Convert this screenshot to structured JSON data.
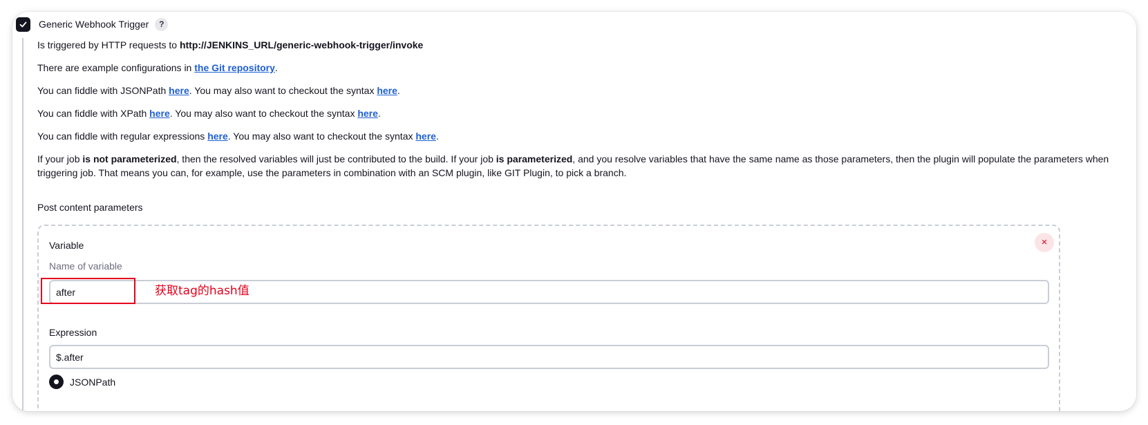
{
  "trigger": {
    "checked": true,
    "title": "Generic Webhook Trigger",
    "help_label": "?"
  },
  "intro": {
    "invoke_prefix": "Is triggered by HTTP requests to ",
    "invoke_url": "http://JENKINS_URL/generic-webhook-trigger/invoke",
    "examples_prefix": "There are example configurations in ",
    "examples_link": "the Git repository",
    "examples_suffix": ".",
    "jsonpath_prefix": "You can fiddle with JSONPath ",
    "xpath_prefix": "You can fiddle with XPath ",
    "regex_prefix": "You can fiddle with regular expressions ",
    "here_link": "here",
    "syntax_middle": ". You may also want to checkout the syntax ",
    "period": "."
  },
  "param_note": {
    "part1": "If your job ",
    "bold1": "is not parameterized",
    "part2": ", then the resolved variables will just be contributed to the build. If your job ",
    "bold2": "is parameterized",
    "part3": ", and you resolve variables that have the same name as those parameters, then the plugin will populate the parameters when triggering job. That means you can, for example, use the parameters in combination with an SCM plugin, like GIT Plugin, to pick a branch."
  },
  "post_params": {
    "section_title": "Post content parameters",
    "delete_icon": "×",
    "variable_label": "Variable",
    "variable_hint": "Name of variable",
    "variable_value": "after",
    "annotation": "获取tag的hash值",
    "expression_label": "Expression",
    "expression_value": "$.after",
    "expression_type": "JSONPath"
  },
  "colors": {
    "link": "#1d5fd1",
    "annotation": "#e3001b",
    "checkbox": "#14141f"
  }
}
